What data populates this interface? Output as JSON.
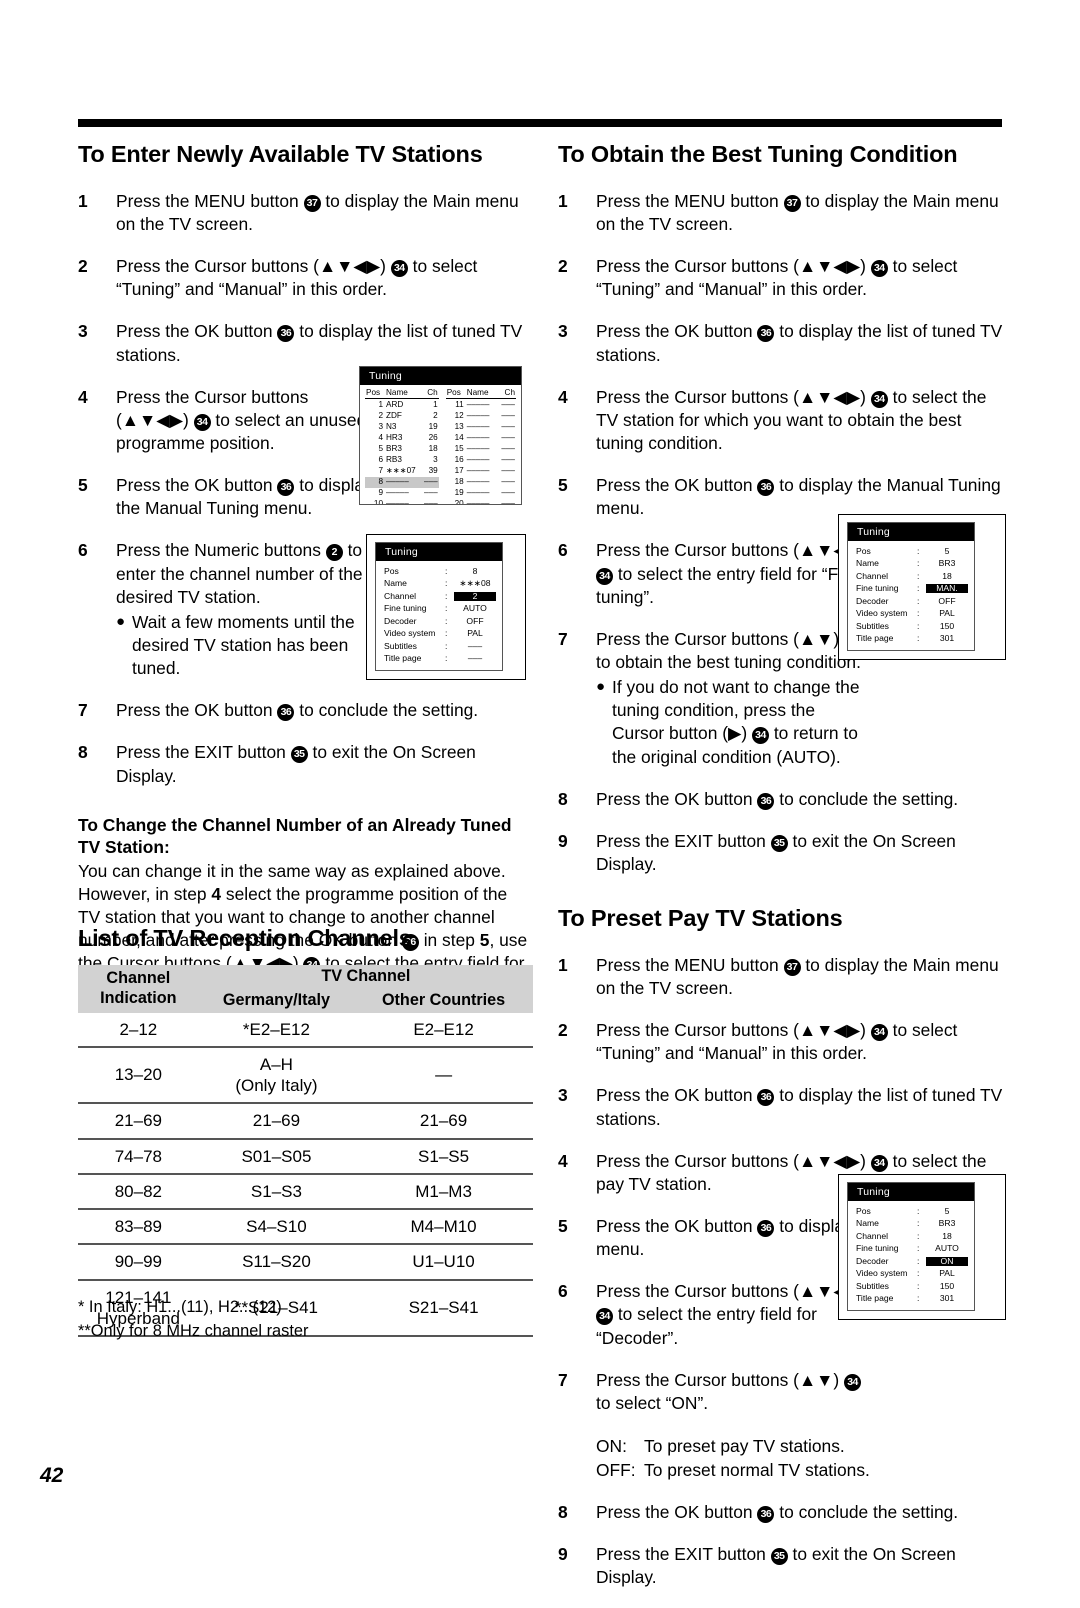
{
  "page": {
    "number": "42"
  },
  "left_column": {
    "section1": {
      "title": "To Enter Newly Available TV Stations",
      "steps": [
        {
          "num": "1",
          "parts": [
            "Press the MENU button ",
            "37",
            " to display the Main menu on the TV screen."
          ]
        },
        {
          "num": "2",
          "parts": [
            "Press the Cursor buttons (▲▼◀▶) ",
            "34",
            " to select “Tuning” and “Manual” in this order."
          ]
        },
        {
          "num": "3",
          "parts": [
            "Press the OK button ",
            "36",
            " to display the list of tuned TV stations."
          ]
        },
        {
          "num": "4",
          "parts": [
            "Press the Cursor buttons (▲▼◀▶) ",
            "34",
            " to select an unused programme position."
          ]
        },
        {
          "num": "5",
          "parts": [
            "Press the OK button ",
            "36",
            " to display the Manual Tuning menu."
          ]
        },
        {
          "num": "6",
          "parts": [
            "Press the Numeric buttons ",
            "2",
            " to enter the channel number of the desired TV station."
          ],
          "bullet": "Wait a few moments until the desired TV station has been tuned."
        },
        {
          "num": "7",
          "parts": [
            "Press the OK button ",
            "36",
            " to conclude the setting."
          ]
        },
        {
          "num": "8",
          "parts": [
            "Press the EXIT button ",
            "35",
            " to exit the On Screen Display."
          ]
        }
      ],
      "subhead": "To Change the Channel Number of an Already Tuned TV Station:",
      "paragraph_1": "You can change it in the same way as explained above. However, in step ",
      "paragraph_step4": "4",
      "paragraph_2": " select the programme position of the TV station that you want to change to another channel number, and after pressing the OK button ",
      "paragraph_cb36": "36",
      "paragraph_3": " in step ",
      "paragraph_step5": "5",
      "paragraph_4": ", use the Cursor buttons (▲▼◀▶) ",
      "paragraph_cb34": "34",
      "paragraph_5": " to select the entry field for “Channel”."
    },
    "table_section": {
      "title": "List of TV Reception Channels",
      "headers": {
        "col1_line1": "Channel",
        "col1_line2": "Indication",
        "col23_group": "TV Channel",
        "col2": "Germany/Italy",
        "col3": "Other Countries"
      },
      "rows": [
        {
          "indication": "2–12",
          "germany_italy": "*E2–E12",
          "other": "E2–E12"
        },
        {
          "indication": "13–20",
          "germany_italy": "A–H\n(Only Italy)",
          "other": "—"
        },
        {
          "indication": "21–69",
          "germany_italy": "21–69",
          "other": "21–69"
        },
        {
          "indication": "74–78",
          "germany_italy": "S01–S05",
          "other": "S1–S5"
        },
        {
          "indication": "80–82",
          "germany_italy": "S1–S3",
          "other": "M1–M3"
        },
        {
          "indication": "83–89",
          "germany_italy": "S4–S10",
          "other": "M4–M10"
        },
        {
          "indication": "90–99",
          "germany_italy": "S11–S20",
          "other": "U1–U10"
        },
        {
          "indication": "121–141\nHyperband",
          "germany_italy": "**S21–S41",
          "other": "S21–S41"
        }
      ],
      "footnote_1": "* In Italy:  H1...(11), H2...(12)",
      "footnote_2": "**Only for 8 MHz channel raster"
    }
  },
  "right_column": {
    "section2": {
      "title": "To Obtain the Best Tuning Condition",
      "steps": [
        {
          "num": "1",
          "parts": [
            "Press the MENU button ",
            "37",
            " to display the Main menu on the TV screen."
          ]
        },
        {
          "num": "2",
          "parts": [
            "Press the Cursor buttons (▲▼◀▶) ",
            "34",
            " to select “Tuning” and “Manual” in this order."
          ]
        },
        {
          "num": "3",
          "parts": [
            "Press the OK button ",
            "36",
            " to display the list of tuned TV stations."
          ]
        },
        {
          "num": "4",
          "parts": [
            "Press the Cursor buttons (▲▼◀▶) ",
            "34",
            " to select the TV station for which you want to obtain the best tuning condition."
          ]
        },
        {
          "num": "5",
          "parts": [
            "Press the OK button ",
            "36",
            " to display the Manual Tuning menu."
          ]
        },
        {
          "num": "6",
          "parts": [
            "Press the Cursor buttons (▲▼◀▶) ",
            "34",
            " to select the entry field for “Fine tuning”."
          ]
        },
        {
          "num": "7",
          "parts": [
            "Press the Cursor buttons (▲▼) ",
            "34",
            " to obtain the best tuning condition."
          ],
          "bullet_pre": "If you do not want to change the tuning condition, press the Cursor button (▶) ",
          "bullet_cb": "34",
          "bullet_post": " to return to the original condition (AUTO)."
        },
        {
          "num": "8",
          "parts": [
            "Press the OK button ",
            "36",
            " to conclude the setting."
          ]
        },
        {
          "num": "9",
          "parts": [
            "Press the EXIT button ",
            "35",
            " to exit the On Screen Display."
          ]
        }
      ]
    },
    "section3": {
      "title": "To Preset Pay TV Stations",
      "steps": [
        {
          "num": "1",
          "parts": [
            "Press the MENU button ",
            "37",
            " to display the Main menu on the TV screen."
          ]
        },
        {
          "num": "2",
          "parts": [
            "Press the Cursor buttons (▲▼◀▶) ",
            "34",
            " to select “Tuning” and “Manual” in this order."
          ]
        },
        {
          "num": "3",
          "parts": [
            "Press the OK button ",
            "36",
            " to display the list of tuned TV stations."
          ]
        },
        {
          "num": "4",
          "parts": [
            "Press the Cursor buttons (▲▼◀▶) ",
            "34",
            " to select the pay TV station."
          ]
        },
        {
          "num": "5",
          "parts": [
            "Press the OK button ",
            "36",
            " to display the Manual Tuning menu."
          ]
        },
        {
          "num": "6",
          "parts": [
            "Press the Cursor buttons (▲▼◀▶) ",
            "34",
            " to select the entry field for “Decoder”."
          ]
        },
        {
          "num": "7",
          "parts": [
            "Press the Cursor buttons (▲▼) ",
            "34",
            " to select “ON”."
          ]
        },
        {
          "num": "8",
          "parts": [
            "Press the OK button ",
            "36",
            " to conclude the setting."
          ]
        },
        {
          "num": "9",
          "parts": [
            "Press the EXIT button ",
            "35",
            " to exit the On Screen Display."
          ]
        }
      ],
      "on_label": "ON:",
      "on_text": "To preset pay TV stations.",
      "off_label": "OFF:",
      "off_text": "To preset normal TV stations."
    }
  },
  "osd_station_list": {
    "title": "Tuning",
    "headers": {
      "pos": "Pos",
      "name": "Name",
      "ch": "Ch"
    },
    "left_rows": [
      {
        "pos": "1",
        "name": "ARD",
        "ch": "1"
      },
      {
        "pos": "2",
        "name": "ZDF",
        "ch": "2"
      },
      {
        "pos": "3",
        "name": "N3",
        "ch": "19"
      },
      {
        "pos": "4",
        "name": "HR3",
        "ch": "26"
      },
      {
        "pos": "5",
        "name": "BR3",
        "ch": "18"
      },
      {
        "pos": "6",
        "name": "RB3",
        "ch": "3"
      },
      {
        "pos": "7",
        "name": "∗∗∗07",
        "ch": "39"
      },
      {
        "pos": "8",
        "name": "–––––",
        "ch": "–––",
        "highlight": true
      },
      {
        "pos": "9",
        "name": "–––––",
        "ch": "–––"
      }
    ],
    "right_rows": [
      {
        "pos": "11",
        "name": "–––––",
        "ch": "–––"
      },
      {
        "pos": "12",
        "name": "–––––",
        "ch": "–––"
      },
      {
        "pos": "13",
        "name": "–––––",
        "ch": "–––"
      },
      {
        "pos": "14",
        "name": "–––––",
        "ch": "–––"
      },
      {
        "pos": "15",
        "name": "–––––",
        "ch": "–––"
      },
      {
        "pos": "16",
        "name": "–––––",
        "ch": "–––"
      },
      {
        "pos": "17",
        "name": "–––––",
        "ch": "–––"
      },
      {
        "pos": "18",
        "name": "–––––",
        "ch": "–––"
      },
      {
        "pos": "19",
        "name": "–––––",
        "ch": "–––"
      }
    ]
  },
  "osd_manual_tuning": {
    "title": "Tuning",
    "rows": [
      {
        "key": "Pos",
        "value": "8"
      },
      {
        "key": "Name",
        "value": "∗∗∗08"
      },
      {
        "key": "Channel",
        "value": "2",
        "highlight": true
      },
      {
        "key": "Fine tuning",
        "value": "AUTO"
      },
      {
        "key": "Decoder",
        "value": "OFF"
      },
      {
        "key": "Video system",
        "value": "PAL"
      },
      {
        "key": "Subtitles",
        "value": "–––"
      },
      {
        "key": "Title page",
        "value": "–––"
      }
    ]
  },
  "osd_fine_tuning": {
    "title": "Tuning",
    "rows": [
      {
        "key": "Pos",
        "value": "5"
      },
      {
        "key": "Name",
        "value": "BR3"
      },
      {
        "key": "Channel",
        "value": "18"
      },
      {
        "key": "Fine tuning",
        "value": "MAN.",
        "highlight": true
      },
      {
        "key": "Decoder",
        "value": "OFF"
      },
      {
        "key": "Video system",
        "value": "PAL"
      },
      {
        "key": "Subtitles",
        "value": "150"
      },
      {
        "key": "Title page",
        "value": "301"
      }
    ]
  },
  "osd_decoder": {
    "title": "Tuning",
    "rows": [
      {
        "key": "Pos",
        "value": "5"
      },
      {
        "key": "Name",
        "value": "BR3"
      },
      {
        "key": "Channel",
        "value": "18"
      },
      {
        "key": "Fine tuning",
        "value": "AUTO"
      },
      {
        "key": "Decoder",
        "value": "ON",
        "highlight": true
      },
      {
        "key": "Video system",
        "value": "PAL"
      },
      {
        "key": "Subtitles",
        "value": "150"
      },
      {
        "key": "Title page",
        "value": "301"
      }
    ]
  }
}
